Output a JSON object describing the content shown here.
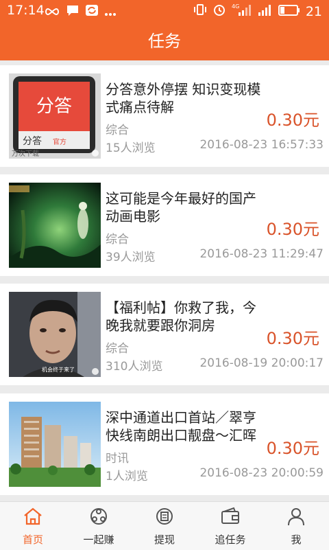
{
  "status_bar": {
    "time": "17:14",
    "battery": "21",
    "network": "4G",
    "icons": [
      "infinity-icon",
      "message-icon",
      "sync-icon",
      "more-dots-icon",
      "vibrate-icon",
      "alarm-icon",
      "signal-icon",
      "battery-icon"
    ]
  },
  "header": {
    "title": "任务"
  },
  "tasks": [
    {
      "title": "分答意外停摆 知识变现模式痛点待解",
      "category": "综合",
      "views": "15人浏览",
      "date": "2016-08-23 16:57:33",
      "price": "0.30元"
    },
    {
      "title": "这可能是今年最好的国产动画电影",
      "category": "综合",
      "views": "39人浏览",
      "date": "2016-08-23 11:29:47",
      "price": "0.30元"
    },
    {
      "title": "【福利帖】你救了我，今晚我就要跟你洞房",
      "category": "综合",
      "views": "310人浏览",
      "date": "2016-08-19 20:00:17",
      "price": "0.30元"
    },
    {
      "title": "深中通道出口首站／翠亨快线南朗出口靓盘～汇晖",
      "category": "时讯",
      "views": "1人浏览",
      "date": "2016-08-23 20:00:59",
      "price": "0.30元"
    }
  ],
  "thumbs": {
    "t1_logo": "分答",
    "t1_sub": "分答",
    "t1_tag": "官方",
    "t1_bottom": "万次下载",
    "t3_caption": "机会终于来了"
  },
  "bottom_nav": [
    {
      "label": "首页",
      "icon": "home-icon",
      "active": true
    },
    {
      "label": "一起赚",
      "icon": "share-icon",
      "active": false
    },
    {
      "label": "提现",
      "icon": "withdraw-icon",
      "active": false
    },
    {
      "label": "追任务",
      "icon": "wallet-icon",
      "active": false
    },
    {
      "label": "我",
      "icon": "user-icon",
      "active": false
    }
  ],
  "colors": {
    "accent": "#f2652a",
    "price": "#d9532a"
  }
}
